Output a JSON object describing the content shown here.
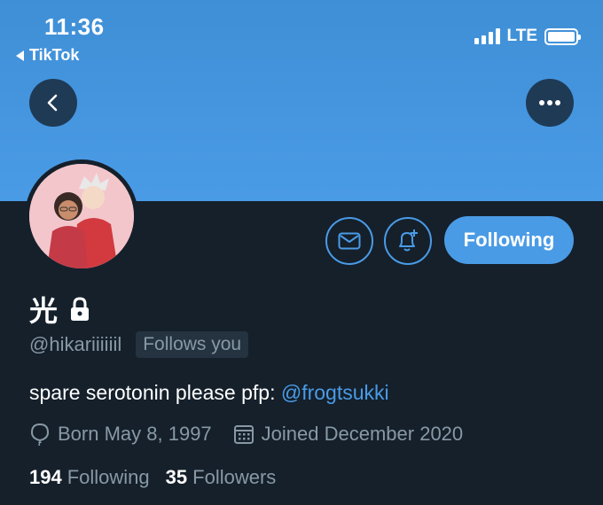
{
  "status_bar": {
    "time": "11:36",
    "back_app": "TikTok",
    "network": "LTE",
    "battery_level": 1.0
  },
  "profile": {
    "display_name": "光",
    "protected_icon": "lock-icon",
    "handle": "@hikariiiiiil",
    "follows_you": "Follows you",
    "bio_text": "spare serotonin please pfp: ",
    "bio_mention": "@frogtsukki",
    "birth": "Born May 8, 1997",
    "joined": "Joined December 2020",
    "following_count": "194",
    "following_label": "Following",
    "followers_count": "35",
    "followers_label": "Followers"
  },
  "actions": {
    "back_icon": "chevron-left-icon",
    "more_icon": "more-horizontal-icon",
    "message_icon": "mail-icon",
    "notify_icon": "bell-plus-icon",
    "follow_button_label": "Following"
  },
  "colors": {
    "accent": "#4a9be6",
    "background": "#15202b",
    "secondary_text": "#8899a6",
    "banner": "#4a9be6"
  }
}
